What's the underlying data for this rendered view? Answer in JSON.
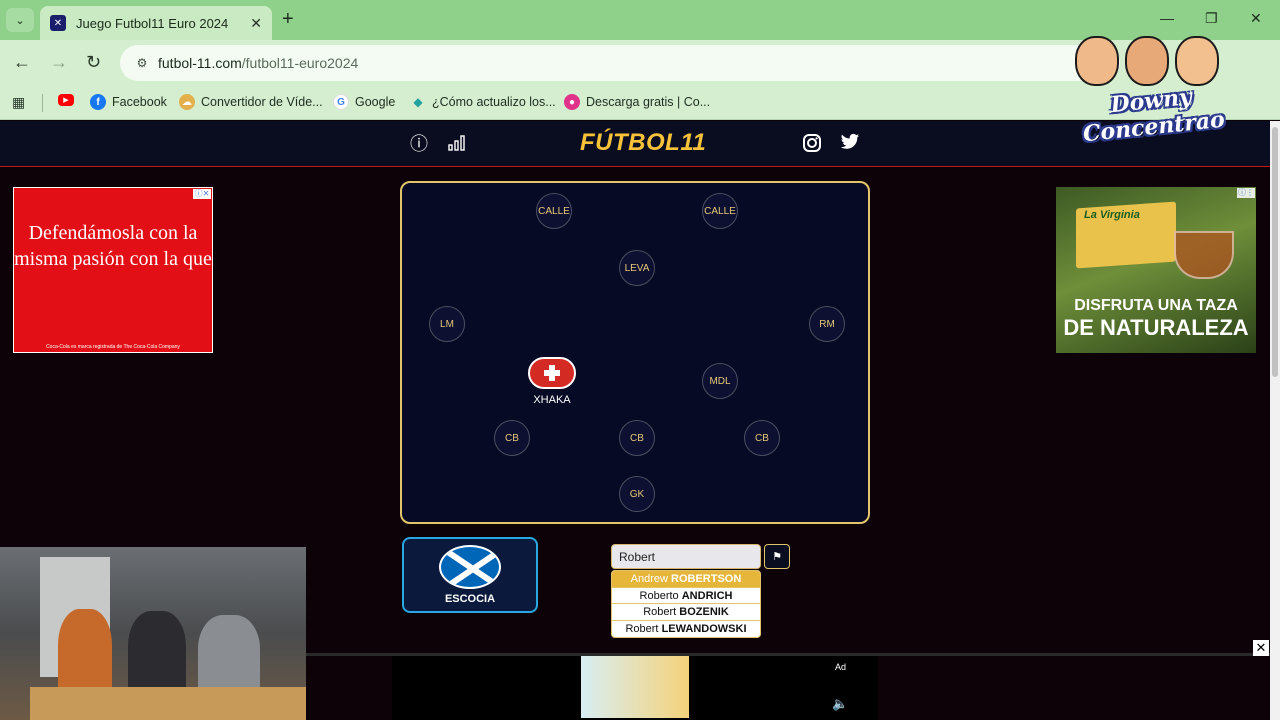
{
  "browser": {
    "tab_title": "Juego Futbol11 Euro 2024",
    "url_host": "futbol-11.com",
    "url_path": "/futbol11-euro2024",
    "bookmarks": [
      {
        "label": "",
        "icon": "youtube-icon",
        "color": "#ff0000"
      },
      {
        "label": "Facebook",
        "icon": "facebook-icon",
        "color": "#1877f2"
      },
      {
        "label": "Convertidor de Víde...",
        "icon": "converter-icon",
        "color": "#e3b04b"
      },
      {
        "label": "Google",
        "icon": "google-icon",
        "color": "#4285f4"
      },
      {
        "label": "¿Cómo actualizo los...",
        "icon": "diamond-icon",
        "color": "#20a39e"
      },
      {
        "label": "Descarga gratis | Co...",
        "icon": "pink-logo-icon",
        "color": "#e0338a"
      }
    ]
  },
  "site": {
    "logo": "FÚTBOL11",
    "accent": "#f5c23a"
  },
  "ads": {
    "left_text": "Defendámosla con la misma pasión con la que",
    "left_footer": "Coca-Cola es marca registrada de The Coca-Cola Company",
    "right_brand": "La Virginia",
    "right_line1": "DISFRUTA UNA TAZA",
    "right_line2": "DE NATURALEZA",
    "bottom_label": "Ad",
    "close": "✕"
  },
  "pitch": {
    "positions": [
      "CALLE",
      "CALLE",
      "LEVA",
      "LM",
      "RM",
      "MDL",
      "CB",
      "CB",
      "CB",
      "GK"
    ],
    "filled_player": "XHAKA"
  },
  "team": {
    "name": "ESCOCIA"
  },
  "search": {
    "value": "Robert",
    "suggestions": [
      {
        "first": "Andrew",
        "last": "ROBERTSON",
        "active": true
      },
      {
        "first": "Roberto",
        "last": "ANDRICH",
        "active": false
      },
      {
        "first": "Robert",
        "last": "BOZENIK",
        "active": false
      },
      {
        "first": "Robert",
        "last": "LEWANDOWSKI",
        "active": false
      }
    ]
  },
  "overlay": {
    "streamer_logo": "Downy Concentrao"
  }
}
